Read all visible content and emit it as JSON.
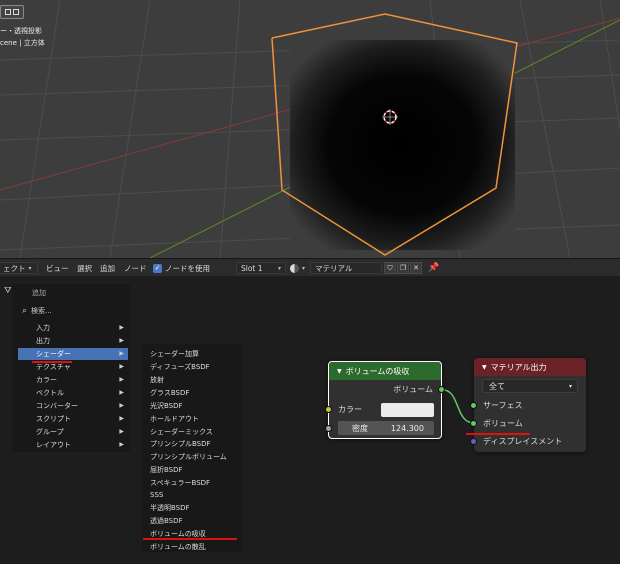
{
  "viewport": {
    "line1": "ー・透視投影",
    "line2": "cene | 立方体"
  },
  "header": {
    "object_menu": "ェクト",
    "menu": [
      "ビュー",
      "選択",
      "追加",
      "ノード"
    ],
    "use_nodes_label": "ノードを使用",
    "slot": "Slot 1",
    "material_name": "マテリアル"
  },
  "add_menu": {
    "title": "追加",
    "search": "検索...",
    "items": [
      "入力",
      "出力",
      "シェーダー",
      "テクスチャ",
      "カラー",
      "ベクトル",
      "コンバーター",
      "スクリプト",
      "グループ",
      "レイアウト"
    ],
    "active_item": "シェーダー"
  },
  "shader_submenu": {
    "items": [
      "シェーダー加算",
      "ディフューズBSDF",
      "放射",
      "グラスBSDF",
      "光沢BSDF",
      "ホールドアウト",
      "シェーダーミックス",
      "プリンシプルBSDF",
      "プリンシプルボリューム",
      "屈折BSDF",
      "スペキュラーBSDF",
      "SSS",
      "半透明BSDF",
      "透過BSDF",
      "ボリュームの吸収",
      "ボリュームの散乱"
    ]
  },
  "absorption_node": {
    "title": "ボリュームの吸収",
    "output": "ボリューム",
    "color_label": "カラー",
    "density_label": "密度",
    "density_value": "124.300"
  },
  "output_node": {
    "title": "マテリアル出力",
    "target": "全て",
    "inputs": [
      "サーフェス",
      "ボリューム",
      "ディスプレイスメント"
    ]
  },
  "colors": {
    "accent": "#4772b3",
    "shader_header": "#2d6a2d",
    "output_header": "#6b2227",
    "selection": "#f0923a",
    "shader_socket": "#63c763",
    "color_socket": "#c7c729",
    "value_socket": "#a1a1a1",
    "vector_socket": "#6363c7",
    "annotation": "#e01010"
  }
}
